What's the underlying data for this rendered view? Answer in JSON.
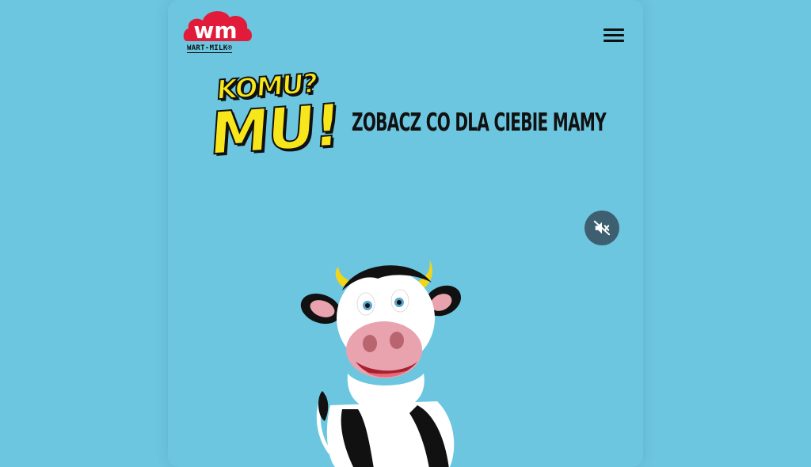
{
  "header": {
    "logo_text": "wm",
    "logo_caption": "WART-MILK®",
    "menu_icon": "hamburger-menu-icon"
  },
  "hero": {
    "title_line1": "KOMU?",
    "title_line2": "MU!",
    "tagline": "ZOBACZ CO DLA CIEBIE MAMY"
  },
  "video": {
    "mute_icon": "volume-off-icon"
  },
  "colors": {
    "background": "#6cc6e0",
    "logo_red": "#e31b3a",
    "title_yellow": "#f7e61b",
    "mute_bg": "#3d5f6f"
  }
}
